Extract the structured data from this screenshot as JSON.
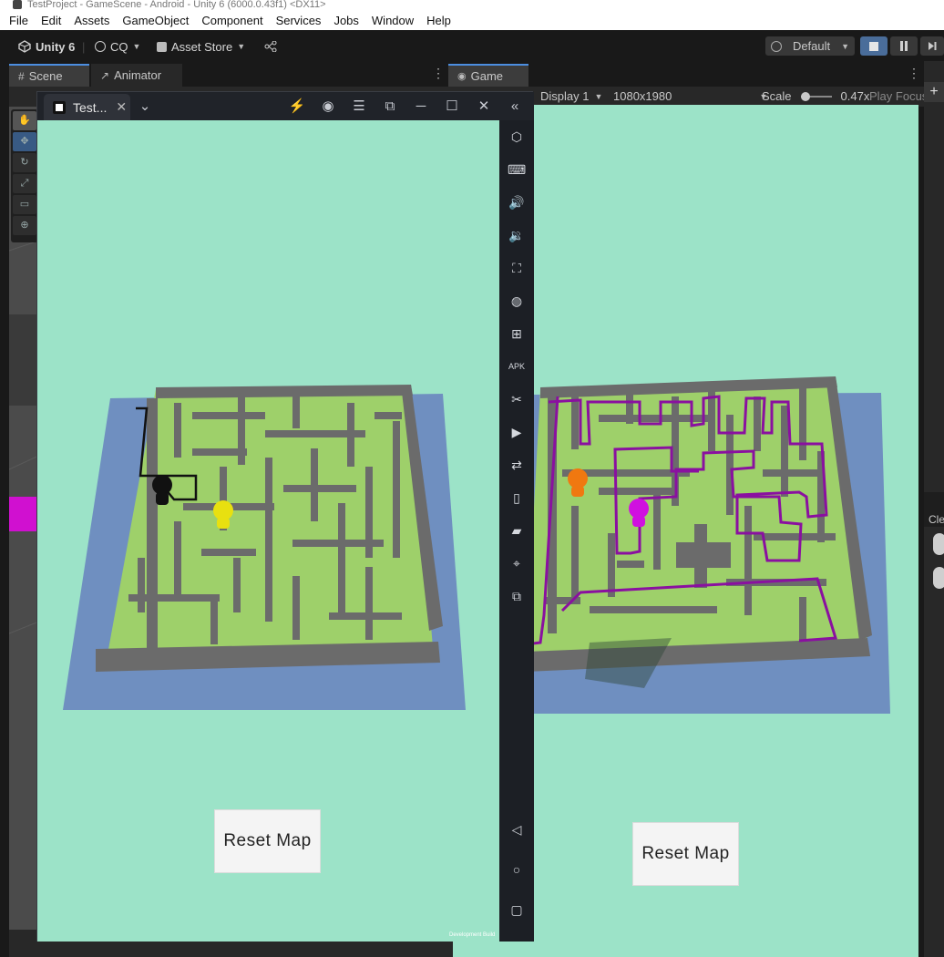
{
  "window": {
    "title": "TestProject - GameScene - Android - Unity 6 (6000.0.43f1) <DX11>"
  },
  "menu": [
    "File",
    "Edit",
    "Assets",
    "GameObject",
    "Component",
    "Services",
    "Jobs",
    "Window",
    "Help"
  ],
  "toolbar": {
    "unity_label": "Unity 6",
    "account": "CQ",
    "asset_store": "Asset Store",
    "layout": "Default"
  },
  "tabs": {
    "scene": "Scene",
    "animator": "Animator",
    "game": "Game"
  },
  "game_bar": {
    "display": "Display 1",
    "resolution": "1080x1980",
    "scale_label": "Scale",
    "scale_value": "0.47x",
    "play_focus": "Play Focus"
  },
  "emulator": {
    "tab_title": "Test...",
    "dev_build": "Development Build"
  },
  "game": {
    "reset_button": "Reset Map",
    "player_colors": {
      "left_black": "#111111",
      "left_yellow": "#e8e010",
      "right_orange": "#f07810",
      "right_magenta": "#d010e0"
    }
  },
  "right_panel": {
    "label": "Cle"
  },
  "colors": {
    "maze_background": "#9ce3c8",
    "floor": "#9ed06a",
    "walls": "#6b6b6b",
    "base": "#6f8fc0",
    "path_purple": "#8a10a0",
    "unity_dark": "#191919",
    "accent_blue": "#4c8ee0"
  },
  "icons": {
    "emulator_sidebar": [
      "hexagon-icon",
      "keyboard-icon",
      "volume-up-icon",
      "volume-down-icon",
      "screenshot-icon",
      "shake-icon",
      "multi-window-icon",
      "apk-icon",
      "scissors-icon",
      "record-icon",
      "sync-icon",
      "rotate-icon",
      "folder-icon",
      "location-icon",
      "multi-instance-icon",
      "back-icon",
      "home-icon",
      "recents-icon"
    ]
  }
}
